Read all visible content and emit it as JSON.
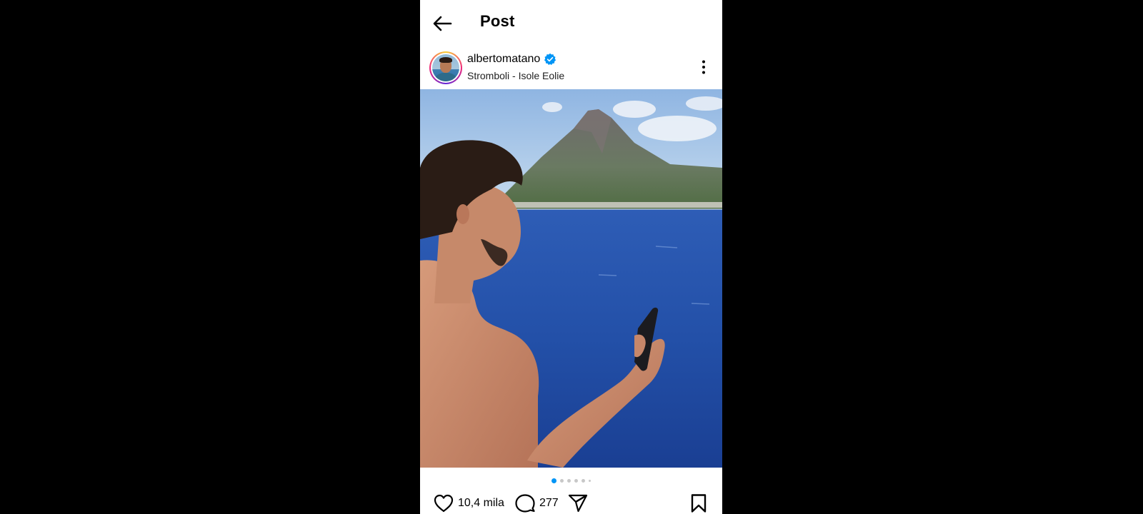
{
  "topbar": {
    "title": "Post",
    "back_icon": "back-arrow-icon"
  },
  "post": {
    "username": "albertomatano",
    "verified": true,
    "location": "Stromboli - Isole Eolie",
    "more_icon": "more-vertical-icon"
  },
  "carousel": {
    "total_slides": 6,
    "active_index": 0,
    "active_color": "#0095f6",
    "inactive_color": "#c8c8c8"
  },
  "actions": {
    "likes": "10,4 mila",
    "comments": "277",
    "like_icon": "heart-icon",
    "comment_icon": "comment-icon",
    "share_icon": "share-icon",
    "save_icon": "bookmark-icon"
  },
  "colors": {
    "verified_blue": "#0095f6",
    "sea": "#1f4fa8",
    "sky": "#a9c8e8"
  }
}
